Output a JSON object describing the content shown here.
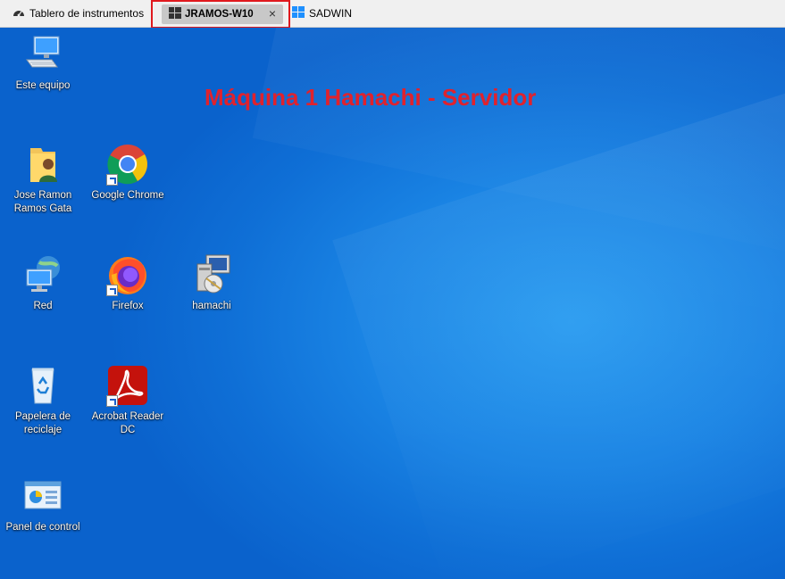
{
  "tabs": [
    {
      "label": "Tablero de instrumentos",
      "icon": "dashboard-icon"
    },
    {
      "label": "JRAMOS-W10",
      "icon": "windows-icon",
      "close": "×",
      "active": true
    },
    {
      "label": "SADWIN",
      "icon": "windows-logo-icon"
    }
  ],
  "headline": "Máquina 1 Hamachi - Servidor",
  "desktop_icons": [
    {
      "label": "Este equipo",
      "icon": "computer-icon"
    },
    {
      "label": "Jose Ramon Ramos Gata",
      "icon": "user-folder-icon"
    },
    {
      "label": "Google Chrome",
      "icon": "chrome-icon"
    },
    {
      "label": "Red",
      "icon": "network-icon"
    },
    {
      "label": "Firefox",
      "icon": "firefox-icon"
    },
    {
      "label": "hamachi",
      "icon": "installer-icon"
    },
    {
      "label": "Papelera de reciclaje",
      "icon": "recycle-bin-icon"
    },
    {
      "label": "Acrobat Reader DC",
      "icon": "acrobat-icon"
    },
    {
      "label": "Panel de control",
      "icon": "control-panel-icon"
    }
  ],
  "colors": {
    "accent_red": "#e0222d",
    "desktop_blue": "#1a84e4",
    "tab_highlight": "#e0191e"
  }
}
